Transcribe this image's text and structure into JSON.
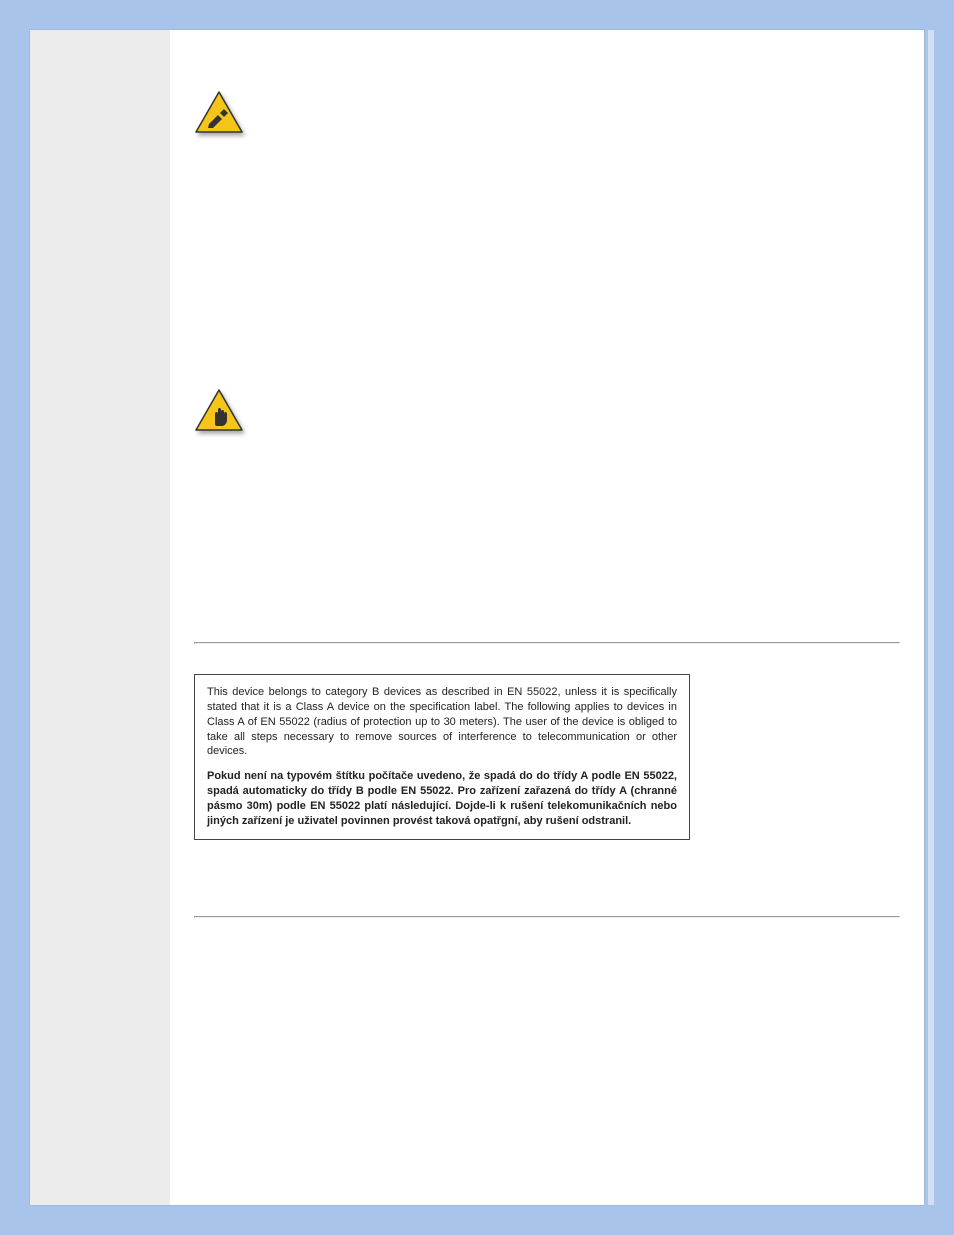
{
  "notice": {
    "english": "This device belongs to category B devices as described in EN 55022, unless it is specifically stated that it is a Class A device on the specification label. The following applies to devices in Class A of EN 55022 (radius of protection up to 30 meters). The user of the device is obliged to take all steps necessary to remove sources of interference to telecommunication or other devices.",
    "czech": "Pokud není na typovém štítku počítače uvedeno, že spadá do do třídy A podle EN 55022, spadá automaticky do třídy B podle EN 55022. Pro zařízení zařazená do třídy A (chranné pásmo 30m) podle EN 55022 platí následující. Dojde-li k rušení telekomunikačních nebo jiných zařízení je uživatel povinnen provést taková opatřgní, aby rušení odstranil."
  },
  "icons": {
    "warning1_alt": "warning-write-icon",
    "warning2_alt": "warning-hand-icon"
  }
}
